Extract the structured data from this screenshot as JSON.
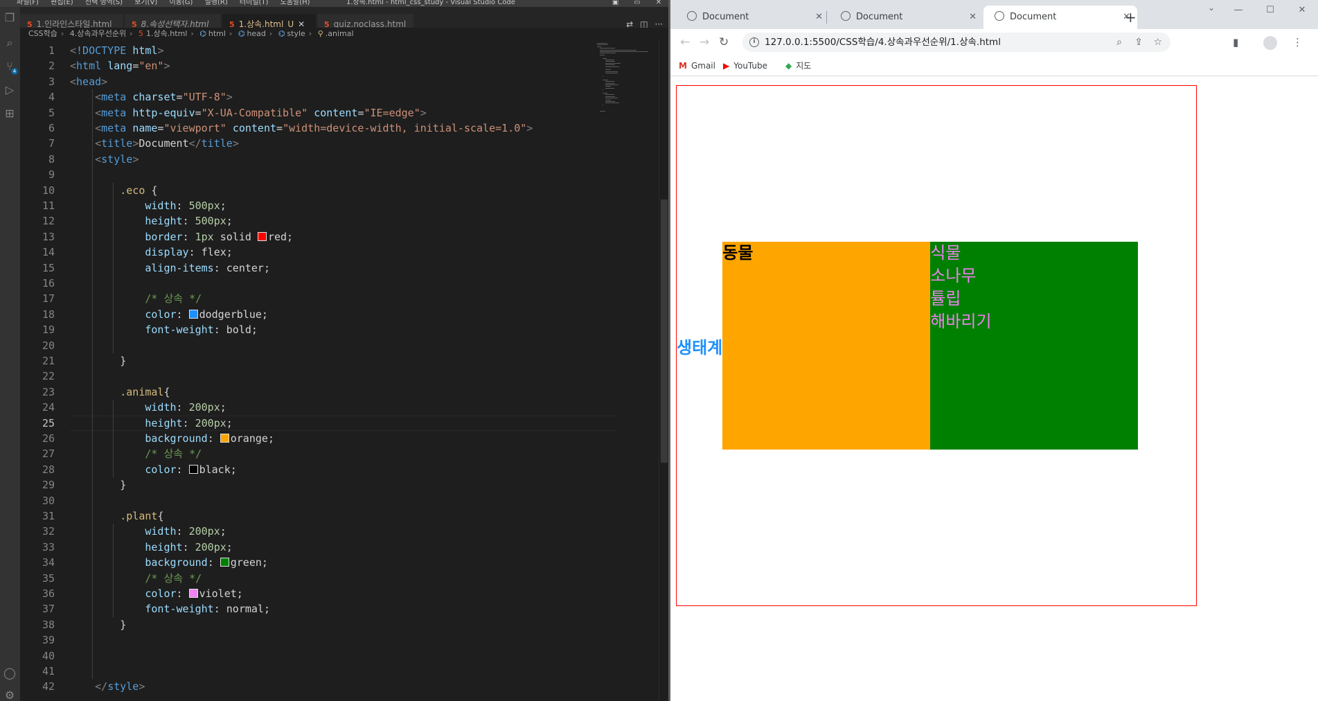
{
  "vscode": {
    "menu": [
      "파일(F)",
      "편집(E)",
      "선택 영역(S)",
      "보기(V)",
      "이동(G)",
      "실행(R)",
      "터미널(T)",
      "도움말(H)"
    ],
    "window_title": "1.상속.html - html_css_study - Visual Studio Code",
    "window_controls": [
      "▣",
      "▭",
      "✕"
    ],
    "source_control_badge": "4",
    "tabs": [
      {
        "label": "1.인라인스타일.html"
      },
      {
        "label": "8.속성선택자.html"
      },
      {
        "label": "1.상속.html",
        "modified": "U"
      },
      {
        "label": "quiz.noclass.html"
      }
    ],
    "breadcrumb": [
      "CSS학습",
      "4.상속과우선순위",
      "1.상속.html",
      "html",
      "head",
      "style",
      ".animal"
    ],
    "current_line": 25,
    "code_lines": [
      "<!DOCTYPE html>",
      "<html lang=\"en\">",
      "<head>",
      "    <meta charset=\"UTF-8\">",
      "    <meta http-equiv=\"X-UA-Compatible\" content=\"IE=edge\">",
      "    <meta name=\"viewport\" content=\"width=device-width, initial-scale=1.0\">",
      "    <title>Document</title>",
      "    <style>",
      "",
      "        .eco {",
      "            width: 500px;",
      "            height: 500px;",
      "            border: 1px solid red;",
      "            display: flex;",
      "            align-items: center;",
      "",
      "            /* 상속 */",
      "            color: dodgerblue;",
      "            font-weight: bold;",
      "",
      "        }",
      "",
      "        .animal{",
      "            width: 200px;",
      "            height: 200px;",
      "            background: orange;",
      "            /* 상속 */",
      "            color: black;",
      "        }",
      "",
      "        .plant{",
      "            width: 200px;",
      "            height: 200px;",
      "            background: green;",
      "            /* 상속 */",
      "            color: violet;",
      "            font-weight: normal;",
      "        }",
      "",
      "",
      "",
      "    </style>"
    ]
  },
  "chrome": {
    "tabs": [
      {
        "title": "Document",
        "active": false
      },
      {
        "title": "Document",
        "active": false
      },
      {
        "title": "Document",
        "active": true
      }
    ],
    "url": "127.0.0.1:5500/CSS학습/4.상속과우선순위/1.상속.html",
    "bookmarks": [
      "Gmail",
      "YouTube",
      "지도"
    ]
  },
  "page": {
    "eco_text": "생태계",
    "animal_text": "동물",
    "plant_items": [
      "식물",
      "소나무",
      "튤립",
      "해바리기"
    ]
  },
  "colors": {
    "eco_border": "#ff0000",
    "eco_text": "#1e90ff",
    "animal_bg": "#ffa500",
    "plant_bg": "#008000",
    "plant_text": "#ee82ee"
  }
}
